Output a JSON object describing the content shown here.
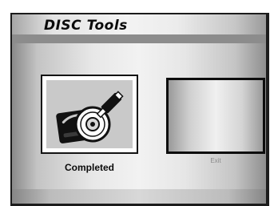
{
  "header": {
    "title": "DISC Tools"
  },
  "menu": {
    "items": [
      {
        "id": "disc",
        "label": "Completed",
        "icon": "disc-drive-cleaning-icon",
        "state": "selected"
      },
      {
        "id": "exit",
        "label": "Exit",
        "icon": "blank-preview",
        "state": "unselected"
      }
    ]
  },
  "colors": {
    "selected_label": "#0a0a0a",
    "unselected_label": "#8a8a8a",
    "frame": "#1c1c1c",
    "icon_fill": "#111111"
  }
}
